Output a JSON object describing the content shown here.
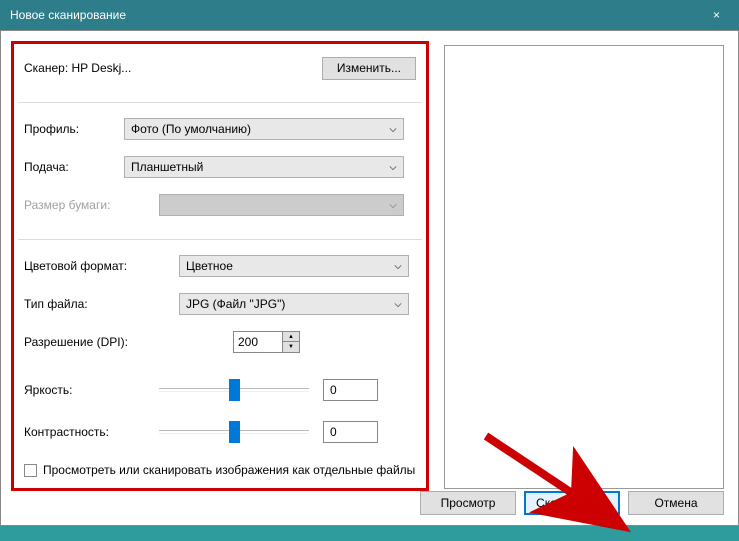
{
  "window": {
    "title": "Новое сканирование",
    "close_label": "×"
  },
  "scanner": {
    "label": "Сканер:",
    "name": "HP Deskj...",
    "change_btn": "Изменить..."
  },
  "fields": {
    "profile_label": "Профиль:",
    "profile_value": "Фото (По умолчанию)",
    "source_label": "Подача:",
    "source_value": "Планшетный",
    "paper_label": "Размер бумаги:",
    "paper_value": "",
    "color_label": "Цветовой формат:",
    "color_value": "Цветное",
    "filetype_label": "Тип файла:",
    "filetype_value": "JPG (Файл \"JPG\")",
    "dpi_label": "Разрешение (DPI):",
    "dpi_value": "200",
    "brightness_label": "Яркость:",
    "brightness_value": "0",
    "contrast_label": "Контрастность:",
    "contrast_value": "0",
    "preview_checkbox": "Просмотреть или сканировать изображения как отдельные файлы"
  },
  "buttons": {
    "preview": "Просмотр",
    "scan": "Сканировать",
    "cancel": "Отмена"
  }
}
